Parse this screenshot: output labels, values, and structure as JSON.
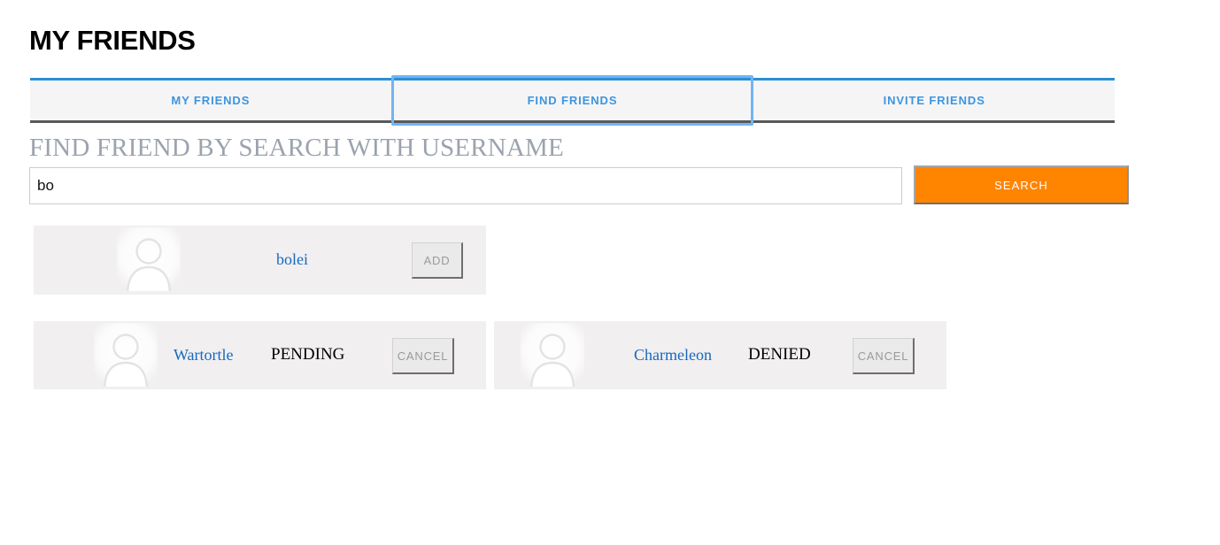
{
  "page": {
    "title": "MY FRIENDS"
  },
  "tabs": [
    {
      "label": "MY FRIENDS",
      "focused": false
    },
    {
      "label": "FIND FRIENDS",
      "focused": true
    },
    {
      "label": "INVITE FRIENDS",
      "focused": false
    }
  ],
  "search": {
    "heading": "FIND FRIEND BY SEARCH WITH USERNAME",
    "value": "bo",
    "placeholder": "",
    "button_label": "SEARCH"
  },
  "results": {
    "search_results": [
      {
        "name": "bolei",
        "status": "",
        "action_label": "ADD",
        "avatar": "default-user-avatar"
      }
    ],
    "requests": [
      {
        "name": "Wartortle",
        "status": "PENDING",
        "action_label": "CANCEL",
        "avatar": "default-user-avatar"
      },
      {
        "name": "Charmeleon",
        "status": "DENIED",
        "action_label": "CANCEL",
        "avatar": "default-user-avatar"
      }
    ]
  },
  "colors": {
    "tab_link": "#3d95e0",
    "tab_top_border": "#2b8fd4",
    "tab_bottom_border": "#595959",
    "focus_ring": "#72b4f4",
    "search_button_bg": "#ff8400",
    "heading_gray": "#9ba3ae",
    "user_link": "#1569c0",
    "card_bg": "#f1eff0"
  }
}
